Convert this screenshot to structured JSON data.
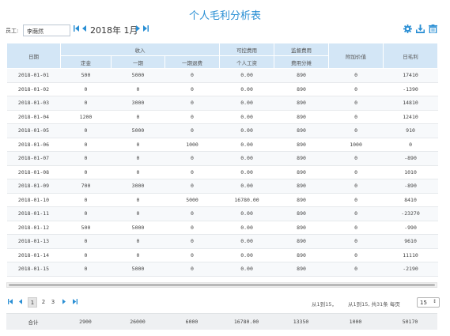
{
  "page": {
    "title": "个人毛利分析表"
  },
  "toolbar": {
    "employee_label": "员工:",
    "employee_value": "李荫然",
    "month_label": "2018年 1月",
    "icons": [
      "gear-icon",
      "download-icon",
      "delete-icon"
    ]
  },
  "colors": {
    "accent": "#2a8fd4",
    "header_bg": "#d3e6f6",
    "footer_bg": "#eef0f2"
  },
  "table": {
    "header_top": {
      "date": "日期",
      "income": "收入",
      "controllable": "可控费用",
      "supervision": "监督费用",
      "addvalue": "附加价值",
      "daily_profit": "日毛利"
    },
    "header_sub": {
      "deposit": "定金",
      "first_period": "一期",
      "first_refund": "一期退费",
      "personal_salary": "个人工资",
      "cost_share": "费用分摊"
    },
    "rows": [
      [
        "2018-01-01",
        "500",
        "5000",
        "0",
        "0.00",
        "890",
        "0",
        "17410"
      ],
      [
        "2018-01-02",
        "0",
        "0",
        "0",
        "0.00",
        "890",
        "0",
        "-1390"
      ],
      [
        "2018-01-03",
        "0",
        "3000",
        "0",
        "0.00",
        "890",
        "0",
        "14810"
      ],
      [
        "2018-01-04",
        "1200",
        "0",
        "0",
        "0.00",
        "890",
        "0",
        "12410"
      ],
      [
        "2018-01-05",
        "0",
        "5000",
        "0",
        "0.00",
        "890",
        "0",
        "910"
      ],
      [
        "2018-01-06",
        "0",
        "0",
        "1000",
        "0.00",
        "890",
        "1000",
        "0"
      ],
      [
        "2018-01-07",
        "0",
        "0",
        "0",
        "0.00",
        "890",
        "0",
        "-890"
      ],
      [
        "2018-01-08",
        "0",
        "0",
        "0",
        "0.00",
        "890",
        "0",
        "1010"
      ],
      [
        "2018-01-09",
        "700",
        "3000",
        "0",
        "0.00",
        "890",
        "0",
        "-890"
      ],
      [
        "2018-01-10",
        "0",
        "0",
        "5000",
        "16780.00",
        "890",
        "0",
        "8410"
      ],
      [
        "2018-01-11",
        "0",
        "0",
        "0",
        "0.00",
        "890",
        "0",
        "-23270"
      ],
      [
        "2018-01-12",
        "500",
        "5000",
        "0",
        "0.00",
        "890",
        "0",
        "-990"
      ],
      [
        "2018-01-13",
        "0",
        "0",
        "0",
        "0.00",
        "890",
        "0",
        "9610"
      ],
      [
        "2018-01-14",
        "0",
        "0",
        "0",
        "0.00",
        "890",
        "0",
        "11110"
      ],
      [
        "2018-01-15",
        "0",
        "5000",
        "0",
        "0.00",
        "890",
        "0",
        "-2190"
      ]
    ]
  },
  "pager": {
    "pages": [
      "1",
      "2",
      "3"
    ],
    "active_page": "1",
    "range_text_1": "从1到15，",
    "range_text_2": "从1到15, 共31条  每页",
    "page_size": "15"
  },
  "footer": {
    "label": "合计",
    "values": [
      "2900",
      "26000",
      "6000",
      "16780.00",
      "13350",
      "1000",
      "50170"
    ]
  }
}
